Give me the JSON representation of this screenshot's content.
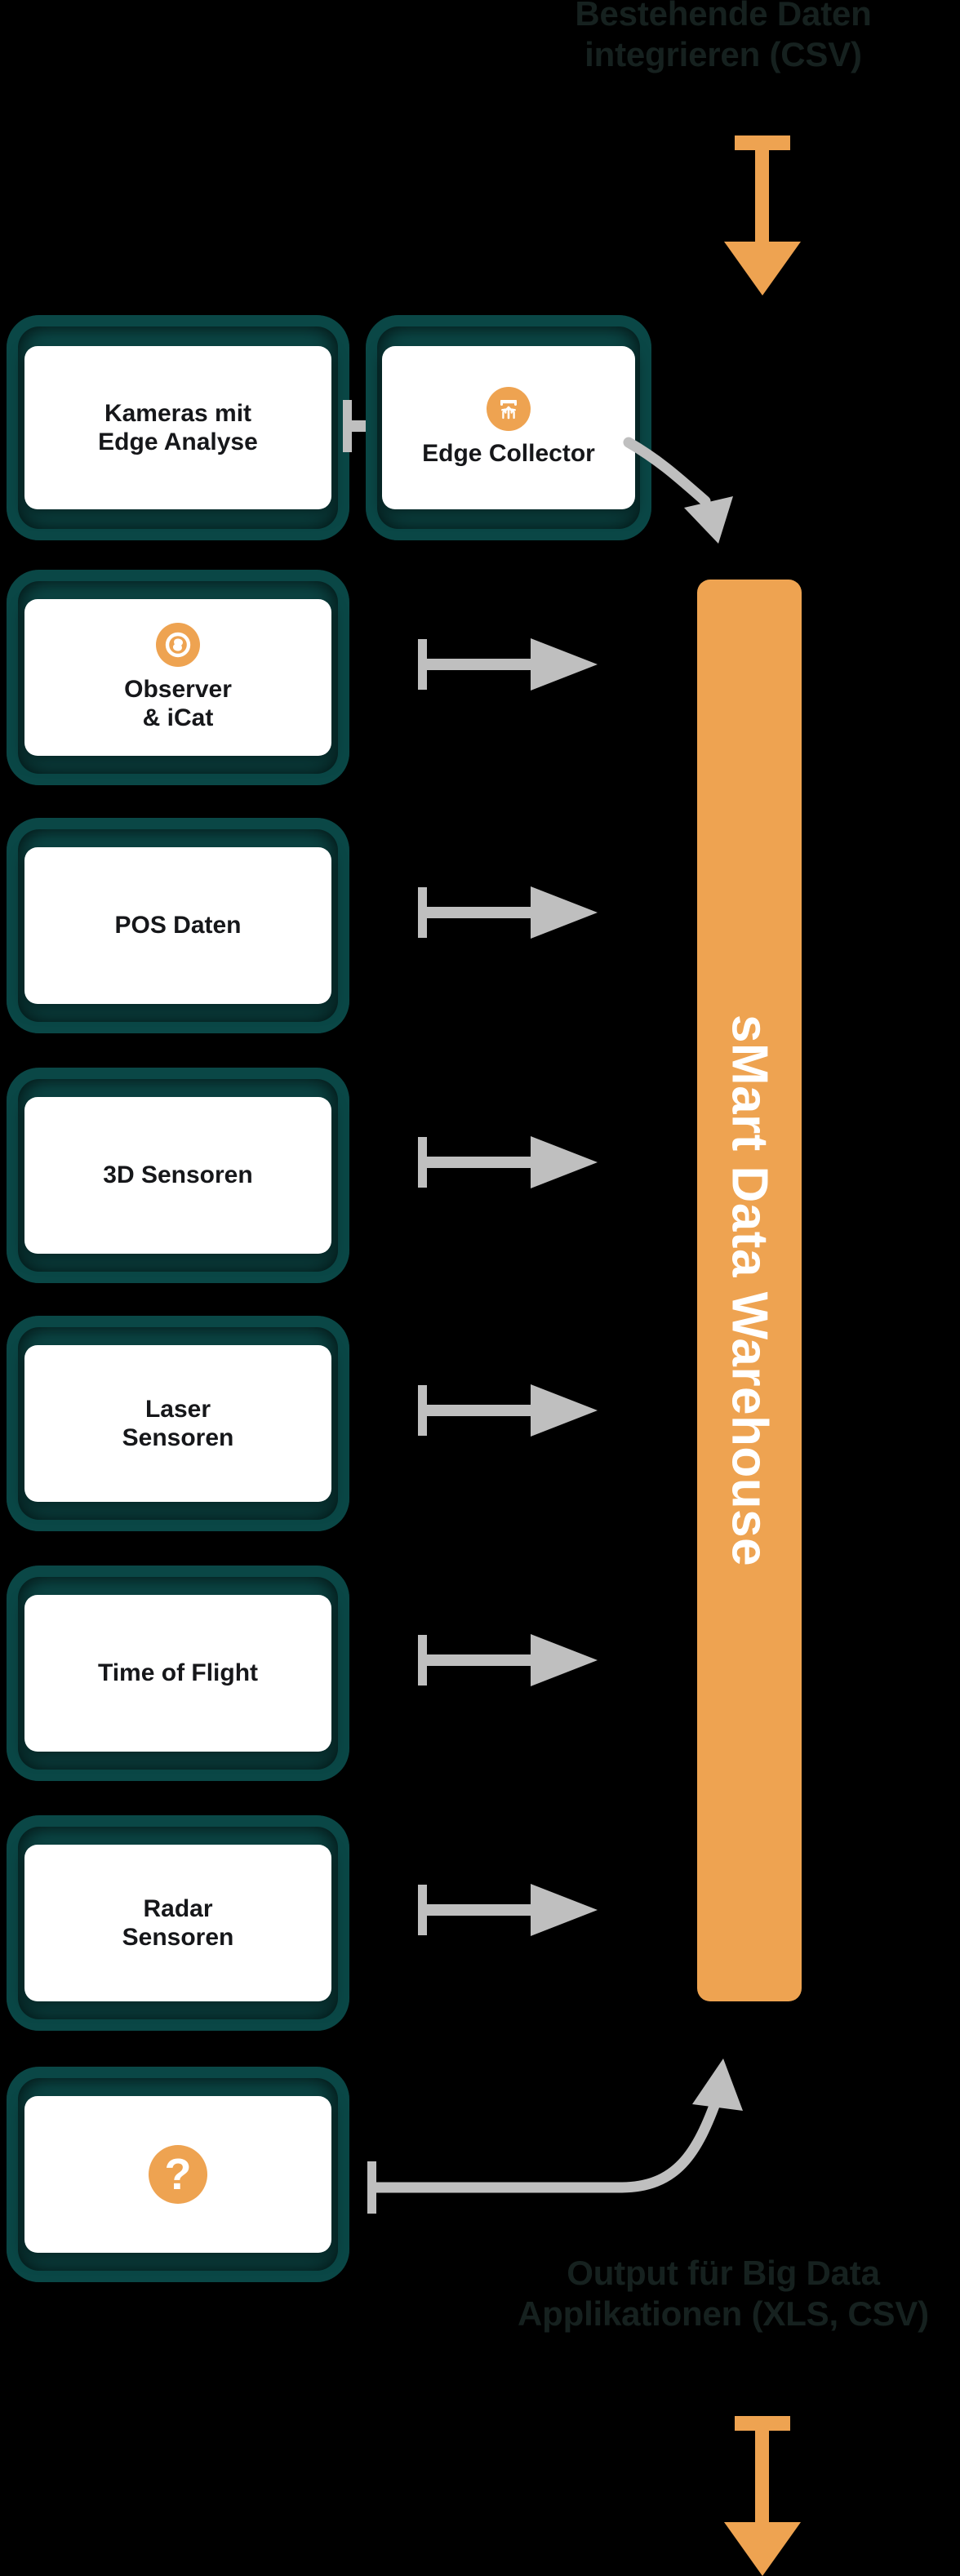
{
  "diagram": {
    "title_top": "Bestehende Daten\nintegrieren (CSV)",
    "title_bottom": "Output für Big Data\nApplikationen (XLS, CSV)",
    "warehouse_label": "sMart Data Warehouse",
    "unknown_icon_glyph": "?"
  },
  "colors": {
    "background": "#000000",
    "accent_orange": "#eea351",
    "shell_teal": "#0d4f4e",
    "shell_teal_inner": "#0a4746",
    "card_white": "#ffffff",
    "arrow_grey": "#bfbfbf",
    "caption_text": "#16211f",
    "label_text": "#16171a"
  },
  "sources": [
    {
      "id": "kameras",
      "label": "Kameras mit\nEdge Analyse",
      "icon": null
    },
    {
      "id": "edge",
      "label": "Edge Collector",
      "icon": "collector-icon"
    },
    {
      "id": "observer",
      "label": "Observer\n& iCat",
      "icon": "aperture-icon"
    },
    {
      "id": "pos",
      "label": "POS Daten",
      "icon": null
    },
    {
      "id": "3d",
      "label": "3D Sensoren",
      "icon": null
    },
    {
      "id": "laser",
      "label": "Laser\nSensoren",
      "icon": null
    },
    {
      "id": "tof",
      "label": "Time of Flight",
      "icon": null
    },
    {
      "id": "radar",
      "label": "Radar\nSensoren",
      "icon": null
    },
    {
      "id": "unknown",
      "label": "",
      "icon": "question-icon"
    }
  ]
}
